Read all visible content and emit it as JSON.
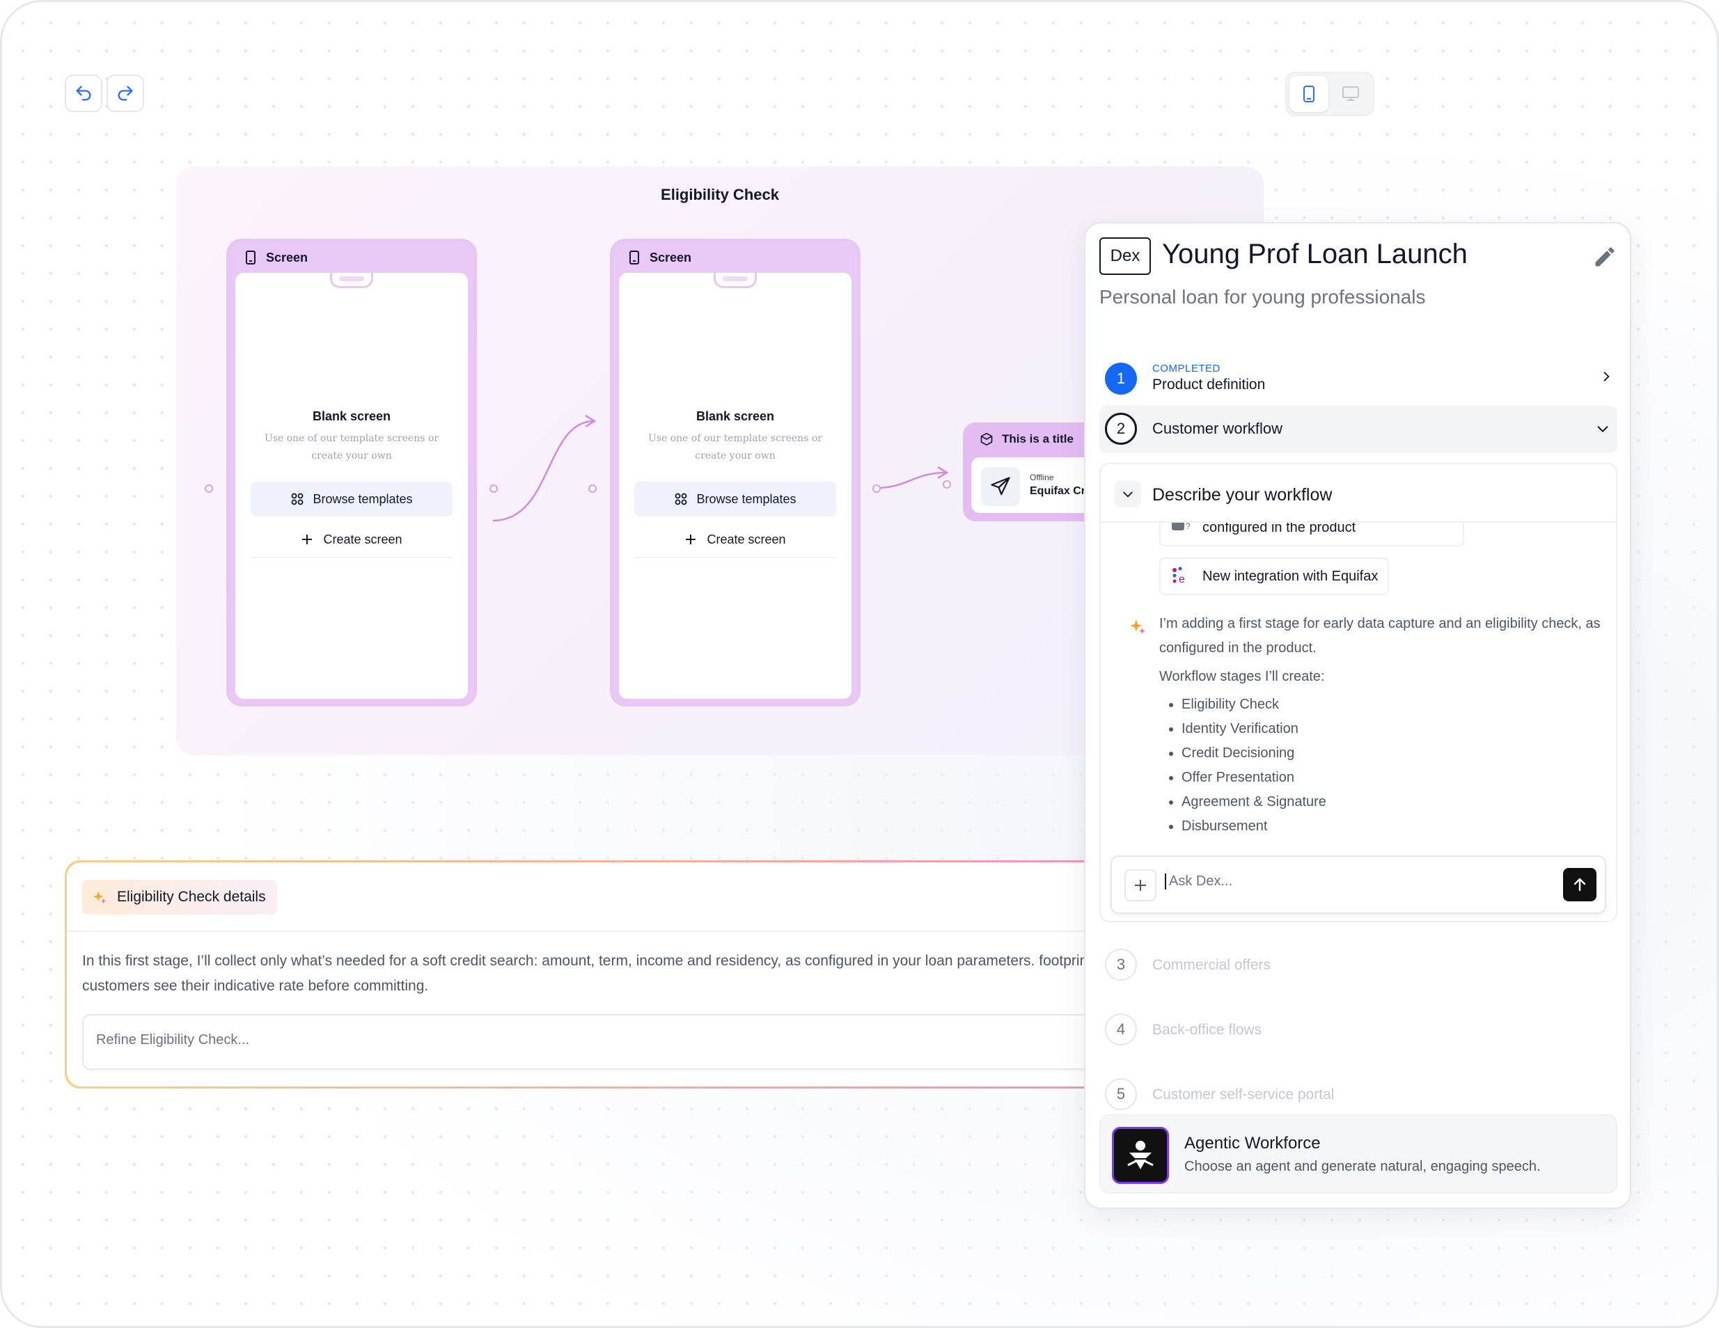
{
  "colors": {
    "accent_blue": "#1368f5",
    "phone_frame": "#e8c6f4",
    "stage_bg": "#fcf3fc",
    "details_border_start": "#f6cf86",
    "details_border_end": "#ef8fb7"
  },
  "toolbar": {
    "undo_icon": "undo-icon",
    "redo_icon": "redo-icon",
    "device_options": [
      "mobile-icon",
      "desktop-icon"
    ],
    "device_selected": "mobile"
  },
  "stage": {
    "title": "Eligibility Check",
    "screens": [
      {
        "header": "Screen",
        "blank_title": "Blank screen",
        "blank_desc": "Use one of our template screens or create your own",
        "browse_label": "Browse templates",
        "create_label": "Create screen"
      },
      {
        "header": "Screen",
        "blank_title": "Blank screen",
        "blank_desc": "Use one of our template screens or create your own",
        "browse_label": "Browse templates",
        "create_label": "Create screen"
      }
    ],
    "integration": {
      "header": "This is a title",
      "status": "Offline",
      "name": "Equifax Cr"
    }
  },
  "details": {
    "chip_label": "Eligibility Check details",
    "text": "In this first stage, I’ll collect only what’s needed for a soft credit search: amount, term, income and residency, as configured in your loan parameters. footprint at this stage so customers see their indicative rate before committing.",
    "refine_placeholder": "Refine Eligibility Check..."
  },
  "panel": {
    "badge": "Dex",
    "title": "Young Prof Loan Launch",
    "subtitle": "Personal loan for young professionals",
    "steps": [
      {
        "num": "1",
        "status": "COMPLETED",
        "label": "Product definition"
      },
      {
        "num": "2",
        "label": "Customer workflow"
      },
      {
        "num": "3",
        "label": "Commercial offers"
      },
      {
        "num": "4",
        "label": "Back-office flows"
      },
      {
        "num": "5",
        "label": "Customer self-service portal"
      }
    ],
    "workflow": {
      "heading": "Describe your workflow",
      "chips": [
        "configured in the product",
        "New integration with Equifax"
      ],
      "message": "I’m adding a first stage for early data capture and an eligibility check, as configured in the product.",
      "list_title": "Workflow stages I’ll create:",
      "stages": [
        "Eligibility Check",
        "Identity Verification",
        "Credit Decisioning",
        "Offer Presentation",
        "Agreement & Signature",
        "Disbursement"
      ],
      "ask_placeholder": "Ask Dex..."
    },
    "agentic": {
      "title": "Agentic Workforce",
      "desc": "Choose an agent and generate natural, engaging speech."
    }
  }
}
